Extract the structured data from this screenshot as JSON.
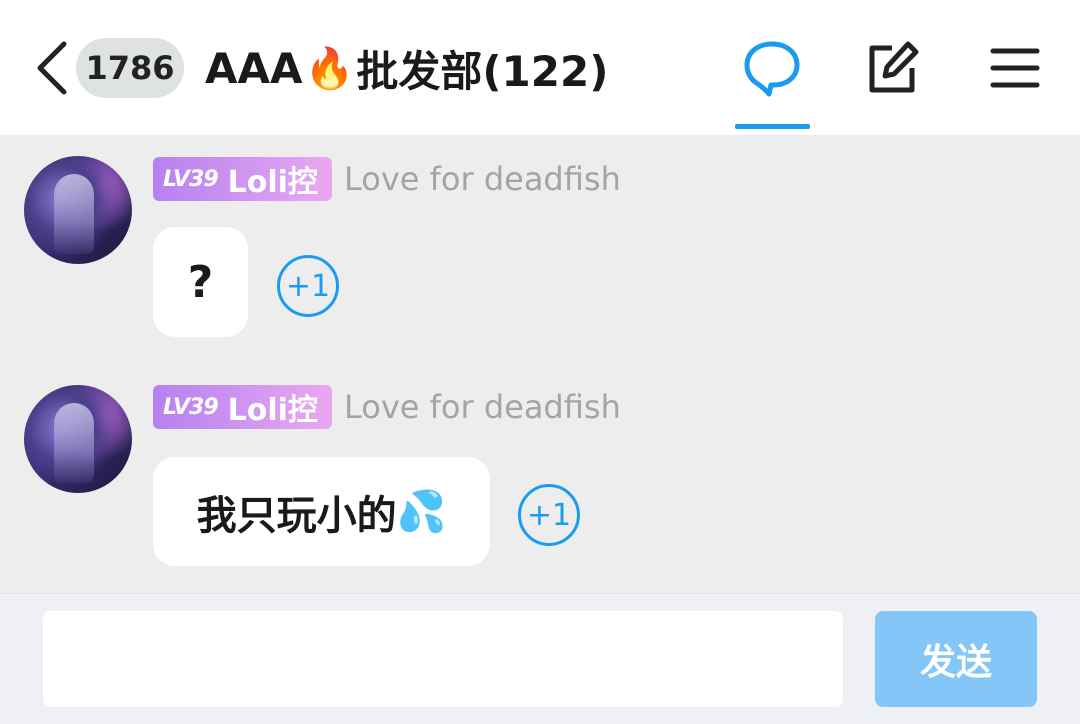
{
  "header": {
    "unread_count": "1786",
    "title": "AAA",
    "title_emoji": "🔥",
    "title_suffix": "批发部(122)",
    "icons": [
      "back-icon",
      "chat-bubble-icon",
      "edit-icon",
      "menu-icon"
    ],
    "accent_color": "#1a9bf0"
  },
  "messages": [
    {
      "level": "LV39",
      "nickname": "Loli控",
      "username": "Love for deadfish",
      "text": "?",
      "plus_one": "+1"
    },
    {
      "level": "LV39",
      "nickname": "Loli控",
      "username": "Love for deadfish",
      "text": "我只玩小的",
      "emoji": "💦",
      "plus_one": "+1"
    }
  ],
  "composer": {
    "value": "",
    "send_label": "发送"
  }
}
